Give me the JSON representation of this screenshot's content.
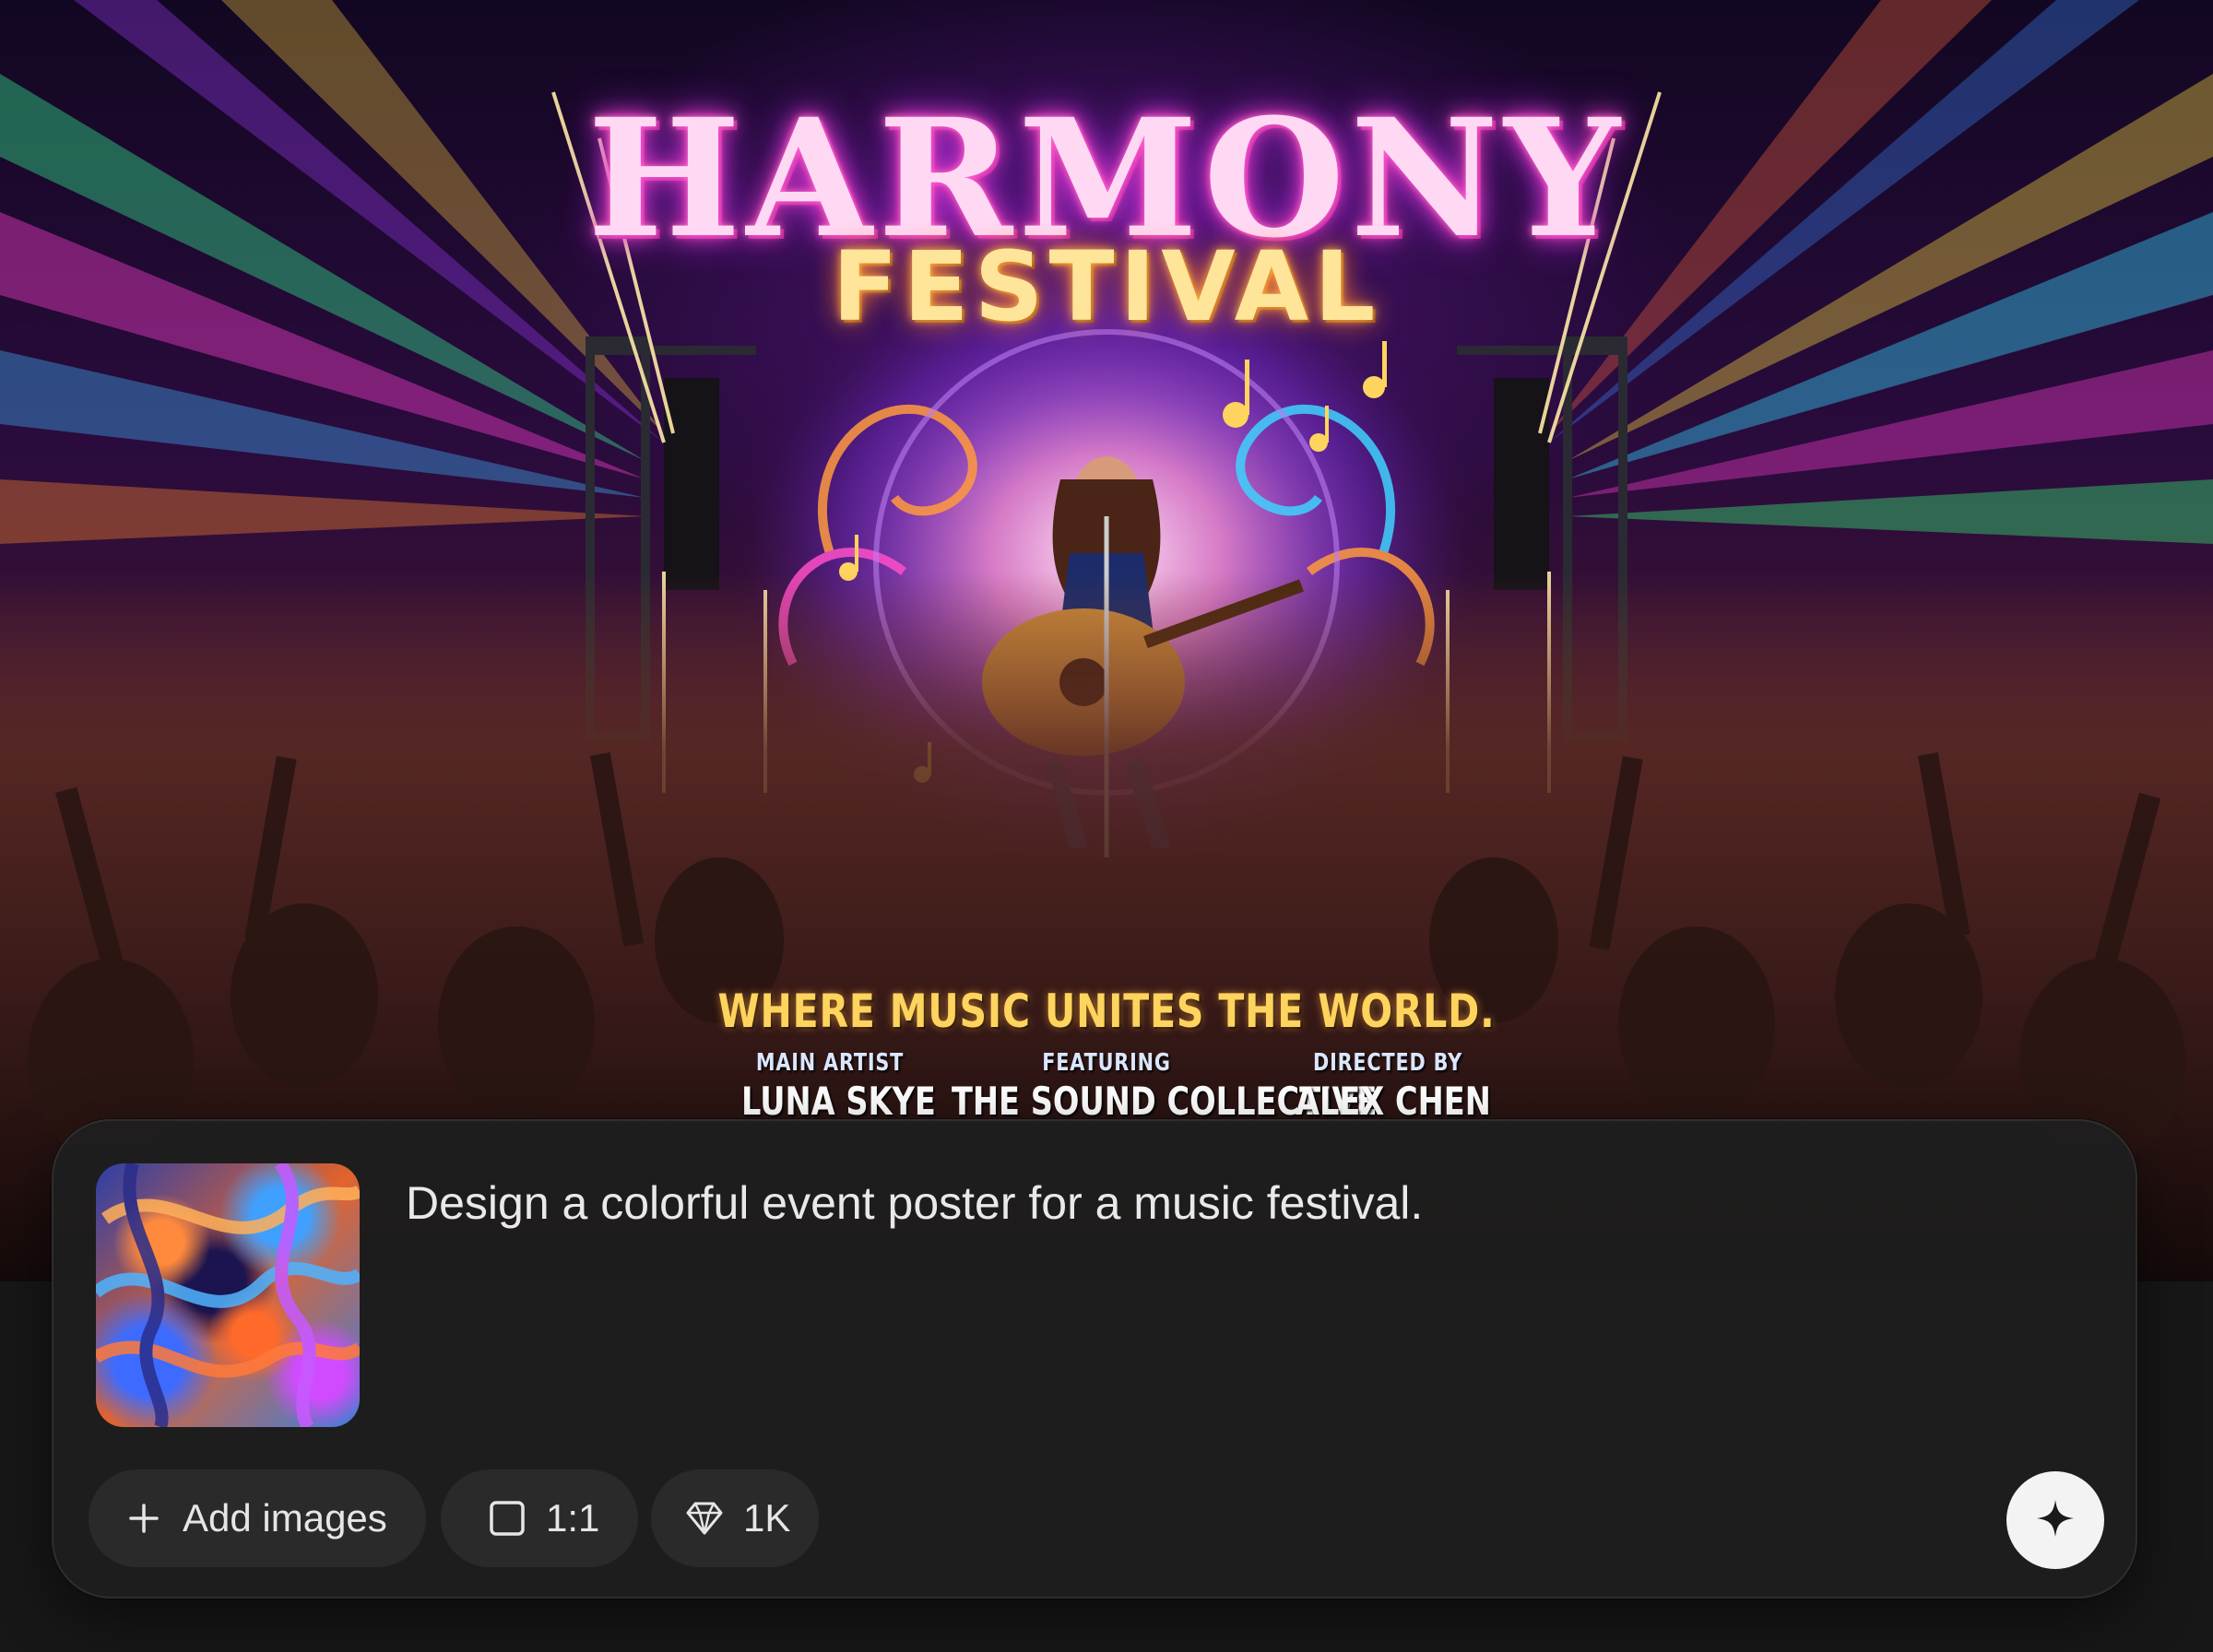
{
  "poster": {
    "title": "HARMONY",
    "subtitle": "FESTIVAL",
    "tagline": "WHERE MUSIC UNITES THE WORLD.",
    "credits": [
      {
        "role": "MAIN ARTIST",
        "name": "LUNA SKYE"
      },
      {
        "role": "FEATURING",
        "name": "THE SOUND COLLECTIVE"
      },
      {
        "role": "DIRECTED BY",
        "name": "ALEX CHEN"
      }
    ]
  },
  "composer": {
    "prompt": "Design a colorful event poster for a music festival.",
    "add_images_label": "Add images",
    "aspect_ratio_label": "1:1",
    "resolution_label": "1K",
    "icons": {
      "add": "plus-icon",
      "ratio": "square-icon",
      "resolution": "diamond-icon",
      "send": "sparkle-icon"
    }
  },
  "colors": {
    "panel_bg": "#1e1e1e",
    "pill_bg": "#2a2a2a",
    "send_bg": "#f3f3f3",
    "text": "#e9e9e9"
  }
}
